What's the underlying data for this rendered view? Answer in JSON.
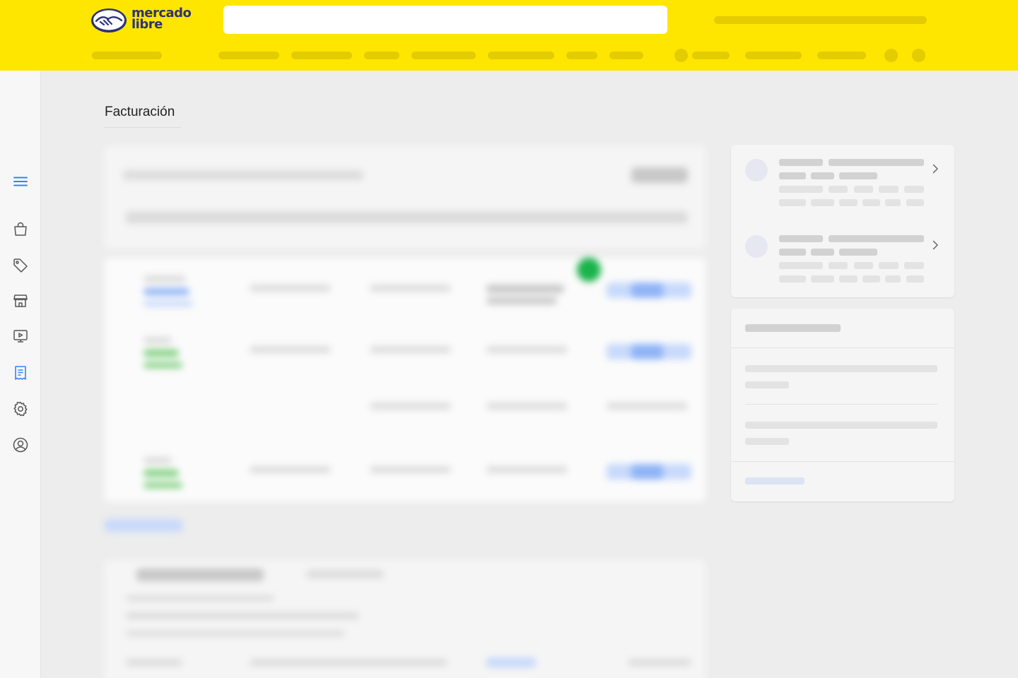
{
  "brand": {
    "name_line1": "mercado",
    "name_line2": "libre"
  },
  "search": {
    "value": "",
    "placeholder": ""
  },
  "page": {
    "title": "Facturación"
  },
  "sidebar": {
    "items": [
      {
        "icon": "menu-icon",
        "active": true
      },
      {
        "icon": "shopping-bag-icon",
        "active": false
      },
      {
        "icon": "price-tag-icon",
        "active": false
      },
      {
        "icon": "store-icon",
        "active": false
      },
      {
        "icon": "video-monitor-icon",
        "active": false
      },
      {
        "icon": "receipt-icon",
        "active": true
      },
      {
        "icon": "settings-gear-icon",
        "active": false
      },
      {
        "icon": "user-profile-icon",
        "active": false
      }
    ]
  },
  "colors": {
    "brand_yellow": "#ffe600",
    "brand_navy": "#2d3277",
    "accent_blue": "#3483fa",
    "background": "#ededed"
  }
}
